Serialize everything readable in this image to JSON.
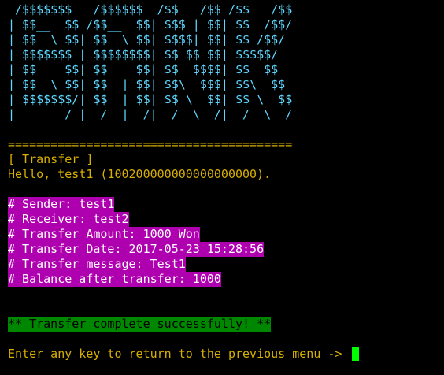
{
  "terminal": {
    "banner_lines": [
      " /$$$$$$$   /$$$$$$  /$$   /$$ /$$   /$$",
      "| $$__  $$ /$$__  $$| $$$ | $$| $$  /$$/",
      "| $$  \\ $$| $$  \\ $$| $$$$| $$| $$ /$$/ ",
      "| $$$$$$$ | $$$$$$$$| $$ $$ $$| $$$$$/  ",
      "| $$__  $$| $$__  $$| $$  $$$$| $$  $$  ",
      "| $$  \\ $$| $$  | $$| $$\\  $$$| $$\\  $$ ",
      "| $$$$$$$/| $$  | $$| $$ \\  $$| $$ \\  $$",
      "|_______/ |__/  |__/|__/  \\__/|__/  \\__/"
    ],
    "separator": "========================================",
    "section_title": "[ Transfer ]",
    "greeting": "Hello, test1 (100200000000000000000).",
    "details": [
      "# Sender: test1",
      "# Receiver: test2",
      "# Transfer Amount: 1000 Won",
      "# Transfer Date: 2017-05-23 15:28:56",
      "# Transfer message: Test1",
      "# Balance after transfer: 1000"
    ],
    "success_message": "** Transfer complete successfully! **",
    "prompt": "Enter any key to return to the previous menu -> "
  },
  "colors": {
    "background": "#000000",
    "banner": "#5fd7ff",
    "text": "#d7af00",
    "highlight_bg": "#af00af",
    "success_bg": "#008700",
    "cursor": "#00ff00"
  }
}
